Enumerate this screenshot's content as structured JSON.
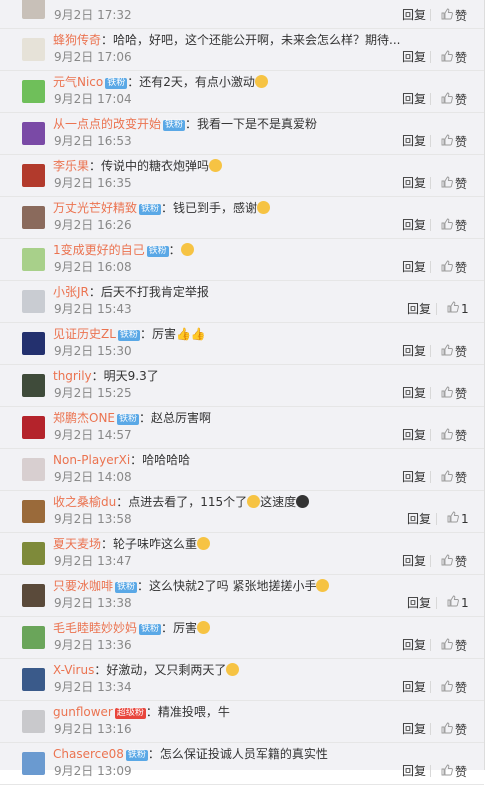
{
  "labels": {
    "reply": "回复",
    "like": "赞"
  },
  "badge_fan": "铁粉",
  "badge_super": "超级粉",
  "comments": [
    {
      "user": "",
      "badge": "",
      "text": "",
      "time": "9月2日 17:32",
      "likes": "",
      "avatar_color": "#c8c0b8"
    },
    {
      "user": "蜂狗传奇",
      "badge": "",
      "text": "：哈哈，好吧，这个还能公开啊，未来会怎么样？期待...",
      "time": "9月2日 17:06",
      "likes": "",
      "avatar_color": "#e6e2d8"
    },
    {
      "user": "元气Nico",
      "badge": "fan",
      "text": "：还有2天，有点小激动",
      "emoji": "dizzy-face",
      "time": "9月2日 17:04",
      "likes": "",
      "avatar_color": "#6fbf5a"
    },
    {
      "user": "从一点点的改变开始",
      "badge": "fan",
      "text": "：我看一下是不是真爱粉",
      "time": "9月2日 16:53",
      "likes": "",
      "avatar_color": "#7a4aa6"
    },
    {
      "user": "李乐果",
      "badge": "",
      "text": "：传说中的糖衣炮弹吗",
      "emoji": "grin-face",
      "time": "9月2日 16:35",
      "likes": "",
      "avatar_color": "#b23a2c"
    },
    {
      "user": "万丈光芒好精致",
      "badge": "fan",
      "text": "：钱已到手，感谢",
      "emoji": "hug-face",
      "time": "9月2日 16:26",
      "likes": "",
      "avatar_color": "#8a6a5c"
    },
    {
      "user": "1变成更好的自己",
      "badge": "fan",
      "text": "：",
      "emoji": "laugh-face",
      "time": "9月2日 16:08",
      "likes": "",
      "avatar_color": "#a8d08a"
    },
    {
      "user": "小张JR",
      "badge": "",
      "text": "：后天不打我肯定举报",
      "time": "9月2日 15:43",
      "likes": "1",
      "avatar_color": "#c9ccd2"
    },
    {
      "user": "见证历史ZL",
      "badge": "fan",
      "text": "：厉害👍👍",
      "time": "9月2日 15:30",
      "likes": "",
      "avatar_color": "#23306e"
    },
    {
      "user": "thgrily",
      "badge": "",
      "text": "：明天9.3了",
      "time": "9月2日 15:25",
      "likes": "",
      "avatar_color": "#3f4b3a"
    },
    {
      "user": "郑鹏杰ONE",
      "badge": "fan",
      "text": "：赵总厉害啊",
      "time": "9月2日 14:57",
      "likes": "",
      "avatar_color": "#b4232b"
    },
    {
      "user": "Non-PlayerXi",
      "badge": "",
      "text": "：哈哈哈哈",
      "time": "9月2日 14:08",
      "likes": "",
      "avatar_color": "#d8cfd0"
    },
    {
      "user": "收之桑榆du",
      "badge": "",
      "text": "：点进去看了，115个了",
      "text2": "这速度",
      "emoji": "cool-face",
      "time": "9月2日 13:58",
      "likes": "1",
      "avatar_color": "#9a6a3a"
    },
    {
      "user": "夏天麦场",
      "badge": "",
      "text": "：轮子味咋这么重",
      "emoji": "smirk-face",
      "time": "9月2日 13:47",
      "likes": "",
      "avatar_color": "#7e8a3a"
    },
    {
      "user": "只要冰咖啡",
      "badge": "fan",
      "text": "：这么快就2了吗 紧张地搓搓小手",
      "emoji": "rub-hands",
      "time": "9月2日 13:38",
      "likes": "1",
      "avatar_color": "#5a4a3a"
    },
    {
      "user": "毛毛睦睦妙妙妈",
      "badge": "fan",
      "text": "：厉害",
      "emoji": "point-hand",
      "time": "9月2日 13:36",
      "likes": "",
      "avatar_color": "#6aa55a"
    },
    {
      "user": "X-Virus",
      "badge": "",
      "text": "：好激动，又只剩两天了",
      "emoji": "scream-face",
      "time": "9月2日 13:34",
      "likes": "",
      "avatar_color": "#3a5a8a"
    },
    {
      "user": "gunflower",
      "badge": "super",
      "text": "：精准投喂，牛",
      "time": "9月2日 13:16",
      "likes": "",
      "avatar_color": "#c9c9cc"
    },
    {
      "user": "Chaserce08",
      "badge": "fan",
      "text": "：怎么保证投诚人员军籍的真实性",
      "time": "9月2日 13:09",
      "likes": "",
      "avatar_color": "#6a9ad0"
    }
  ]
}
